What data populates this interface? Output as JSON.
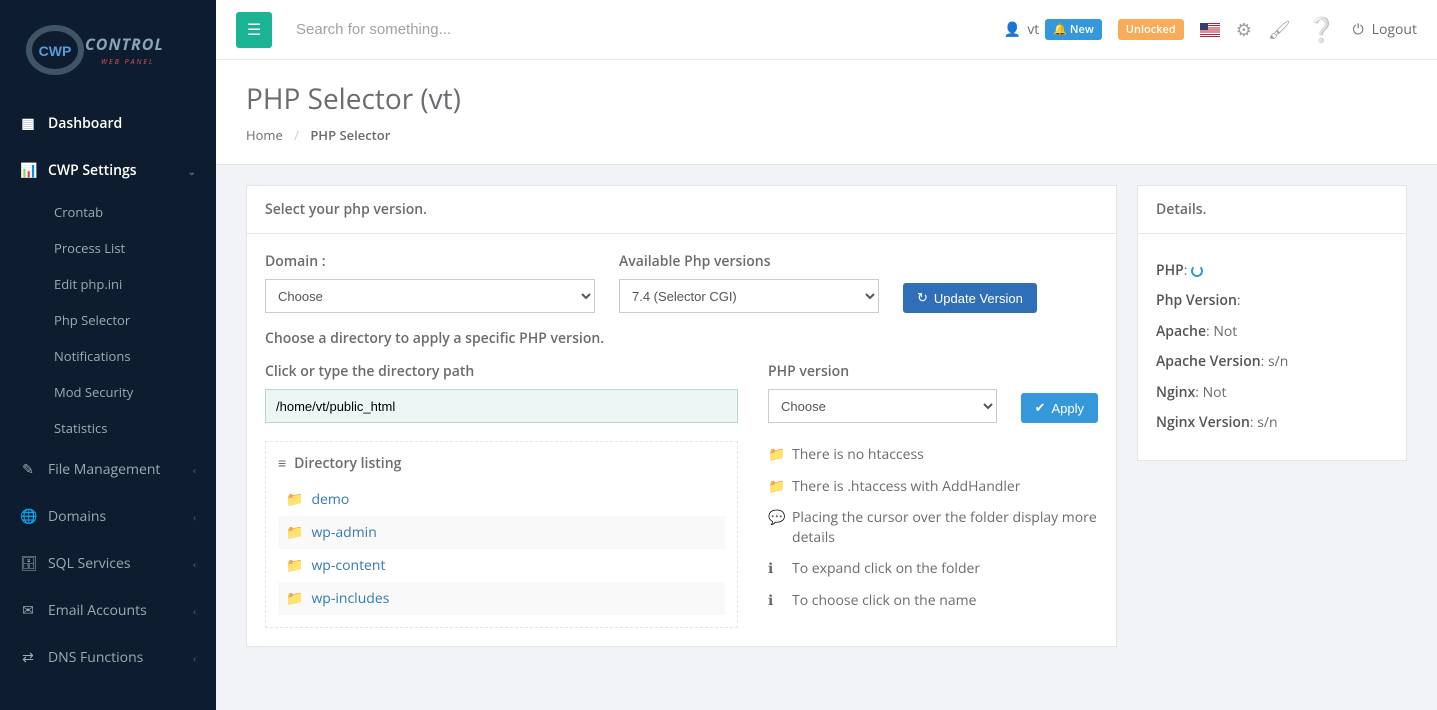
{
  "brand": {
    "name": "CWP CONTROL",
    "subtitle": "WEB PANEL"
  },
  "topbar": {
    "search_placeholder": "Search for something...",
    "username": "vt",
    "new_label": "New",
    "unlocked_label": "Unlocked",
    "logout_label": "Logout"
  },
  "sidebar": {
    "items": [
      {
        "icon": "dashboard-icon",
        "label": "Dashboard"
      },
      {
        "icon": "chart-icon",
        "label": "CWP Settings",
        "expanded": true,
        "children": [
          {
            "label": "Crontab"
          },
          {
            "label": "Process List"
          },
          {
            "label": "Edit php.ini"
          },
          {
            "label": "Php Selector"
          },
          {
            "label": "Notifications"
          },
          {
            "label": "Mod Security"
          },
          {
            "label": "Statistics"
          }
        ]
      },
      {
        "icon": "file-icon",
        "label": "File Management"
      },
      {
        "icon": "globe-icon",
        "label": "Domains"
      },
      {
        "icon": "database-icon",
        "label": "SQL Services"
      },
      {
        "icon": "mail-icon",
        "label": "Email Accounts"
      },
      {
        "icon": "dns-icon",
        "label": "DNS Functions"
      }
    ]
  },
  "page": {
    "title": "PHP Selector (vt)",
    "breadcrumb_home": "Home",
    "breadcrumb_current": "PHP Selector"
  },
  "main": {
    "panel_title": "Select your php version.",
    "domain_label": "Domain :",
    "domain_selected": "Choose",
    "avail_label": "Available Php versions",
    "avail_selected": "7.4 (Selector CGI)",
    "update_btn": "Update Version",
    "choose_dir_heading": "Choose a directory to apply a specific PHP version.",
    "path_label": "Click or type the directory path",
    "path_value": "/home/vt/public_html",
    "phpver_label": "PHP version",
    "phpver_selected": "Choose",
    "apply_btn": "Apply",
    "dir_listing_title": "Directory listing",
    "directories": [
      {
        "name": "demo"
      },
      {
        "name": "wp-admin"
      },
      {
        "name": "wp-content"
      },
      {
        "name": "wp-includes"
      }
    ],
    "legend": {
      "no_htaccess": "There is no htaccess",
      "has_htaccess": "There is .htaccess with AddHandler",
      "hover_tip": "Placing the cursor over the folder display more details",
      "expand_tip": "To expand click on the folder",
      "choose_tip": "To choose click on the name"
    }
  },
  "details": {
    "title": "Details.",
    "php_label": "PHP",
    "phpver_label": "Php Version",
    "apache_label": "Apache",
    "apache_value": "Not",
    "apache_ver_label": "Apache Version",
    "apache_ver_value": "s/n",
    "nginx_label": "Nginx",
    "nginx_value": "Not",
    "nginx_ver_label": "Nginx Version",
    "nginx_ver_value": "s/n"
  }
}
